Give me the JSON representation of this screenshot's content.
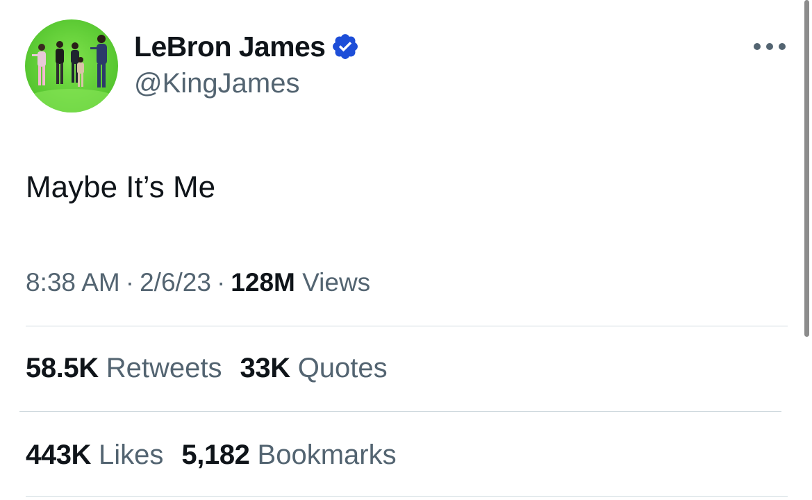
{
  "tweet": {
    "display_name": "LeBron James",
    "handle": "@KingJames",
    "verified_color": "#1d9bf0",
    "avatar_background": "#6ad13a",
    "text": "Maybe It’s Me",
    "time": "8:38 AM",
    "separator": "·",
    "date": "2/6/23",
    "views_count": "128M",
    "views_label": "Views"
  },
  "stats": {
    "retweets_count": "58.5K",
    "retweets_label": "Retweets",
    "quotes_count": "33K",
    "quotes_label": "Quotes",
    "likes_count": "443K",
    "likes_label": "Likes",
    "bookmarks_count": "5,182",
    "bookmarks_label": "Bookmarks"
  },
  "icons": {
    "verified": "verified-badge-icon",
    "more": "more-options-icon"
  }
}
